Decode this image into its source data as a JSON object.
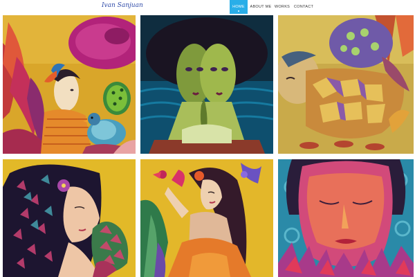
{
  "header": {
    "logo_text": "Ivan Sanjuan",
    "nav": [
      {
        "label": "HOME",
        "active": true
      },
      {
        "label": "ABOUT ME",
        "active": false
      },
      {
        "label": "WORKS",
        "active": false
      },
      {
        "label": "CONTACT",
        "active": false
      }
    ],
    "accent_color": "#29aee8"
  },
  "gallery": {
    "columns": 3,
    "rows": 2,
    "items": [
      {
        "subject": "figure-with-birds"
      },
      {
        "subject": "two-faces-in-water"
      },
      {
        "subject": "sleeping-figure-with-patchwork"
      },
      {
        "subject": "woman-with-flower-in-hair"
      },
      {
        "subject": "woman-holding-bird"
      },
      {
        "subject": "portrait-with-closed-eyes"
      }
    ]
  }
}
